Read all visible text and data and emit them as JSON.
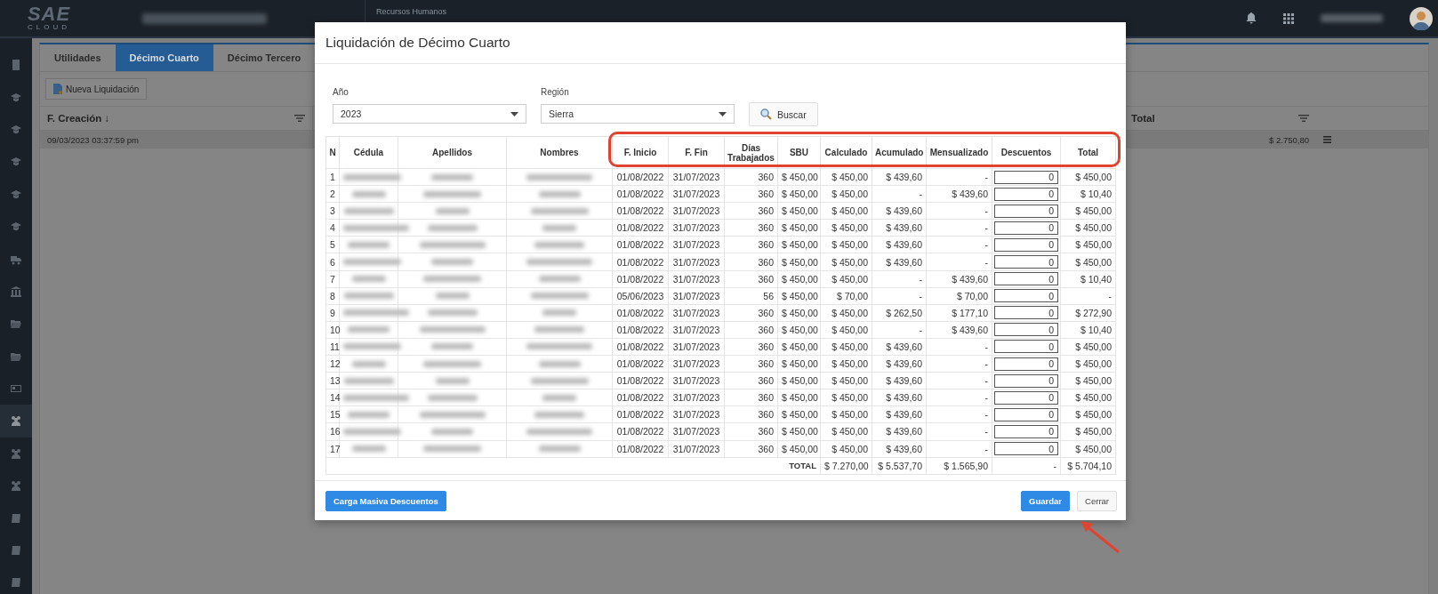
{
  "topbar": {
    "logo": "SAE",
    "logo_sub": "CLOUD",
    "module": "Recursos Humanos"
  },
  "sidebar": {
    "items": [
      {
        "kind": "building",
        "selected": false
      },
      {
        "kind": "cap",
        "selected": false
      },
      {
        "kind": "cap",
        "selected": false
      },
      {
        "kind": "cap",
        "selected": false
      },
      {
        "kind": "cap",
        "selected": false
      },
      {
        "kind": "cap",
        "selected": false
      },
      {
        "kind": "truck",
        "selected": false
      },
      {
        "kind": "bank",
        "selected": false
      },
      {
        "kind": "folder",
        "selected": false
      },
      {
        "kind": "folder",
        "selected": false
      },
      {
        "kind": "card",
        "selected": false
      },
      {
        "kind": "users",
        "selected": true
      },
      {
        "kind": "users",
        "selected": false
      },
      {
        "kind": "users",
        "selected": false
      },
      {
        "kind": "book",
        "selected": false
      },
      {
        "kind": "book",
        "selected": false
      },
      {
        "kind": "book",
        "selected": false
      }
    ]
  },
  "tabs": [
    {
      "label": "Utilidades",
      "selected": false
    },
    {
      "label": "Décimo Cuarto",
      "selected": true
    },
    {
      "label": "Décimo Tercero",
      "selected": false
    }
  ],
  "new_button": "Nueva Liquidación",
  "grid": {
    "columns": [
      "F. Creación ↓",
      "Total"
    ],
    "rows": [
      {
        "created": "09/03/2023 03:37:59 pm",
        "total": "$ 2.750,80"
      }
    ]
  },
  "dialog": {
    "title": "Liquidación de Décimo Cuarto",
    "filters": [
      {
        "label": "Año",
        "value": "2023"
      },
      {
        "label": "Región",
        "value": "Sierra"
      }
    ],
    "search_button": "Buscar",
    "columns": [
      {
        "label": "N",
        "kind": "index"
      },
      {
        "label": "Cédula",
        "kind": "redacted"
      },
      {
        "label": "Apellidos",
        "kind": "redacted"
      },
      {
        "label": "Nombres",
        "kind": "redacted"
      },
      {
        "label": "F. Inicio",
        "kind": "text"
      },
      {
        "label": "F. Fin",
        "kind": "text"
      },
      {
        "label": "Días Trabajados",
        "kind": "number"
      },
      {
        "label": "SBU",
        "kind": "number"
      },
      {
        "label": "Calculado",
        "kind": "number"
      },
      {
        "label": "Acumulado",
        "kind": "number"
      },
      {
        "label": "Mensualizado",
        "kind": "number"
      },
      {
        "label": "Descuentos",
        "kind": "input"
      },
      {
        "label": "Total",
        "kind": "number"
      }
    ],
    "rows": [
      {
        "cells": [
          "1",
          "",
          "",
          "",
          "01/08/2022",
          "31/07/2023",
          "360",
          "$ 450,00",
          "$ 450,00",
          "$ 439,60",
          "-",
          "0",
          "$ 450,00"
        ]
      },
      {
        "cells": [
          "2",
          "",
          "",
          "",
          "01/08/2022",
          "31/07/2023",
          "360",
          "$ 450,00",
          "$ 450,00",
          "-",
          "$ 439,60",
          "0",
          "$ 10,40"
        ]
      },
      {
        "cells": [
          "3",
          "",
          "",
          "",
          "01/08/2022",
          "31/07/2023",
          "360",
          "$ 450,00",
          "$ 450,00",
          "$ 439,60",
          "-",
          "0",
          "$ 450,00"
        ]
      },
      {
        "cells": [
          "4",
          "",
          "",
          "",
          "01/08/2022",
          "31/07/2023",
          "360",
          "$ 450,00",
          "$ 450,00",
          "$ 439,60",
          "-",
          "0",
          "$ 450,00"
        ]
      },
      {
        "cells": [
          "5",
          "",
          "",
          "",
          "01/08/2022",
          "31/07/2023",
          "360",
          "$ 450,00",
          "$ 450,00",
          "$ 439,60",
          "-",
          "0",
          "$ 450,00"
        ]
      },
      {
        "cells": [
          "6",
          "",
          "",
          "",
          "01/08/2022",
          "31/07/2023",
          "360",
          "$ 450,00",
          "$ 450,00",
          "$ 439,60",
          "-",
          "0",
          "$ 450,00"
        ]
      },
      {
        "cells": [
          "7",
          "",
          "",
          "",
          "01/08/2022",
          "31/07/2023",
          "360",
          "$ 450,00",
          "$ 450,00",
          "-",
          "$ 439,60",
          "0",
          "$ 10,40"
        ]
      },
      {
        "cells": [
          "8",
          "",
          "",
          "",
          "05/06/2023",
          "31/07/2023",
          "56",
          "$ 450,00",
          "$ 70,00",
          "-",
          "$ 70,00",
          "0",
          "-"
        ]
      },
      {
        "cells": [
          "9",
          "",
          "",
          "",
          "01/08/2022",
          "31/07/2023",
          "360",
          "$ 450,00",
          "$ 450,00",
          "$ 262,50",
          "$ 177,10",
          "0",
          "$ 272,90"
        ]
      },
      {
        "cells": [
          "10",
          "",
          "",
          "",
          "01/08/2022",
          "31/07/2023",
          "360",
          "$ 450,00",
          "$ 450,00",
          "-",
          "$ 439,60",
          "0",
          "$ 10,40"
        ]
      },
      {
        "cells": [
          "11",
          "",
          "",
          "",
          "01/08/2022",
          "31/07/2023",
          "360",
          "$ 450,00",
          "$ 450,00",
          "$ 439,60",
          "-",
          "0",
          "$ 450,00"
        ]
      },
      {
        "cells": [
          "12",
          "",
          "",
          "",
          "01/08/2022",
          "31/07/2023",
          "360",
          "$ 450,00",
          "$ 450,00",
          "$ 439,60",
          "-",
          "0",
          "$ 450,00"
        ]
      },
      {
        "cells": [
          "13",
          "",
          "",
          "",
          "01/08/2022",
          "31/07/2023",
          "360",
          "$ 450,00",
          "$ 450,00",
          "$ 439,60",
          "-",
          "0",
          "$ 450,00"
        ]
      },
      {
        "cells": [
          "14",
          "",
          "",
          "",
          "01/08/2022",
          "31/07/2023",
          "360",
          "$ 450,00",
          "$ 450,00",
          "$ 439,60",
          "-",
          "0",
          "$ 450,00"
        ]
      },
      {
        "cells": [
          "15",
          "",
          "",
          "",
          "01/08/2022",
          "31/07/2023",
          "360",
          "$ 450,00",
          "$ 450,00",
          "$ 439,60",
          "-",
          "0",
          "$ 450,00"
        ]
      },
      {
        "cells": [
          "16",
          "",
          "",
          "",
          "01/08/2022",
          "31/07/2023",
          "360",
          "$ 450,00",
          "$ 450,00",
          "$ 439,60",
          "-",
          "0",
          "$ 450,00"
        ]
      },
      {
        "cells": [
          "17",
          "",
          "",
          "",
          "01/08/2022",
          "31/07/2023",
          "360",
          "$ 450,00",
          "$ 450,00",
          "$ 439,60",
          "-",
          "0",
          "$ 450,00"
        ]
      }
    ],
    "totals": {
      "label": "TOTAL",
      "values": [
        "$ 7.270,00",
        "$ 5.537,70",
        "$ 1.565,90",
        "-",
        "$ 5.704,10"
      ]
    },
    "footer_buttons": [
      {
        "label": "Carga Masiva Descuentos",
        "kind": "primary"
      },
      {
        "label": "Guardar",
        "kind": "primary"
      },
      {
        "label": "Cerrar",
        "kind": "secondary"
      }
    ]
  }
}
